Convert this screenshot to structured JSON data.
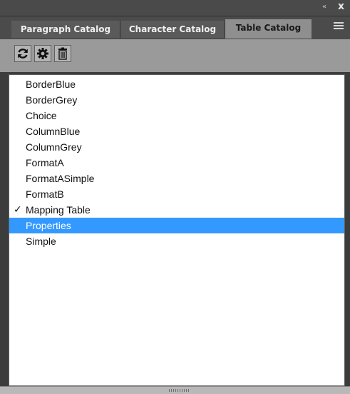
{
  "titlebar": {
    "collapse_icon": "«",
    "close_icon": "x"
  },
  "tabs": [
    {
      "label": "Paragraph Catalog",
      "active": false
    },
    {
      "label": "Character Catalog",
      "active": false
    },
    {
      "label": "Table Catalog",
      "active": true
    }
  ],
  "toolbar": {
    "buttons": [
      "refresh-icon",
      "gear-icon",
      "delete-icon"
    ]
  },
  "list": {
    "items": [
      {
        "label": "BorderBlue",
        "checked": false,
        "selected": false
      },
      {
        "label": "BorderGrey",
        "checked": false,
        "selected": false
      },
      {
        "label": "Choice",
        "checked": false,
        "selected": false
      },
      {
        "label": "ColumnBlue",
        "checked": false,
        "selected": false
      },
      {
        "label": "ColumnGrey",
        "checked": false,
        "selected": false
      },
      {
        "label": "FormatA",
        "checked": false,
        "selected": false
      },
      {
        "label": "FormatASimple",
        "checked": false,
        "selected": false
      },
      {
        "label": "FormatB",
        "checked": false,
        "selected": false
      },
      {
        "label": "Mapping Table",
        "checked": true,
        "selected": false
      },
      {
        "label": "Properties",
        "checked": false,
        "selected": true
      },
      {
        "label": "Simple",
        "checked": false,
        "selected": false
      }
    ],
    "check_mark": "✓"
  },
  "colors": {
    "selection": "#3399ff",
    "panel": "#3c3c3c",
    "toolbar": "#9a9a9a"
  }
}
